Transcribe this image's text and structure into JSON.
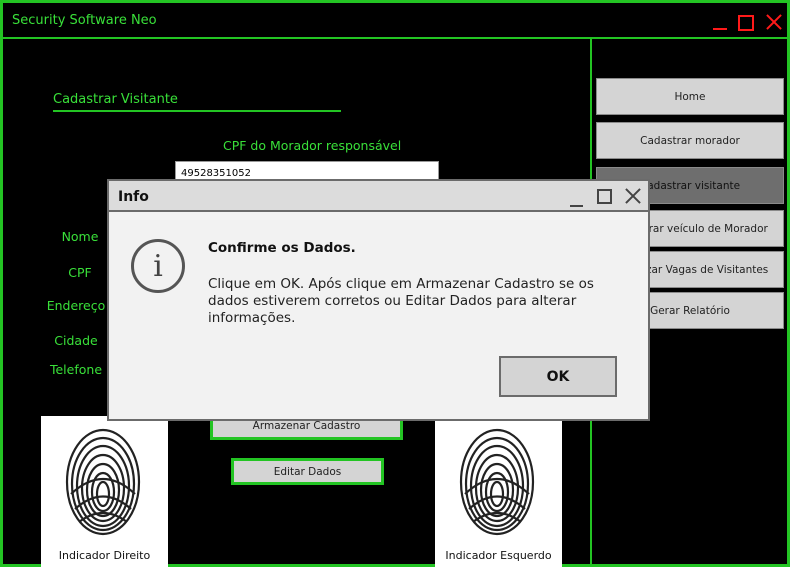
{
  "window": {
    "title": "Security Software Neo"
  },
  "form": {
    "section_title": "Cadastrar Visitante",
    "cpf_morador_label": "CPF do Morador responsável",
    "cpf_morador_value": "49528351052",
    "labels": {
      "nome": "Nome",
      "cpf": "CPF",
      "endereco": "Endereço",
      "cidade": "Cidade",
      "telefone": "Telefone"
    },
    "armazenar_label": "Armazenar Cadastro",
    "editar_label": "Editar Dados"
  },
  "sidebar": {
    "items": [
      {
        "label": "Home"
      },
      {
        "label": "Cadastrar morador"
      },
      {
        "label": "Cadastrar visitante"
      },
      {
        "label": "Cadastrar veículo de Morador"
      },
      {
        "label": "Visualizar Vagas de Visitantes"
      },
      {
        "label": "Gerar Relatório"
      }
    ]
  },
  "fingerprints": {
    "right_label": "Indicador Direito",
    "left_label": "Indicador Esquerdo"
  },
  "dialog": {
    "title": "Info",
    "heading": "Confirme os Dados.",
    "message": "Clique em OK. Após clique em Armazenar Cadastro se os dados estiverem corretos ou Editar Dados para alterar informações.",
    "ok_label": "OK",
    "icon": "info-icon"
  },
  "colors": {
    "accent": "#23c423",
    "window_controls": "#ff1a1a",
    "background": "#000000"
  }
}
